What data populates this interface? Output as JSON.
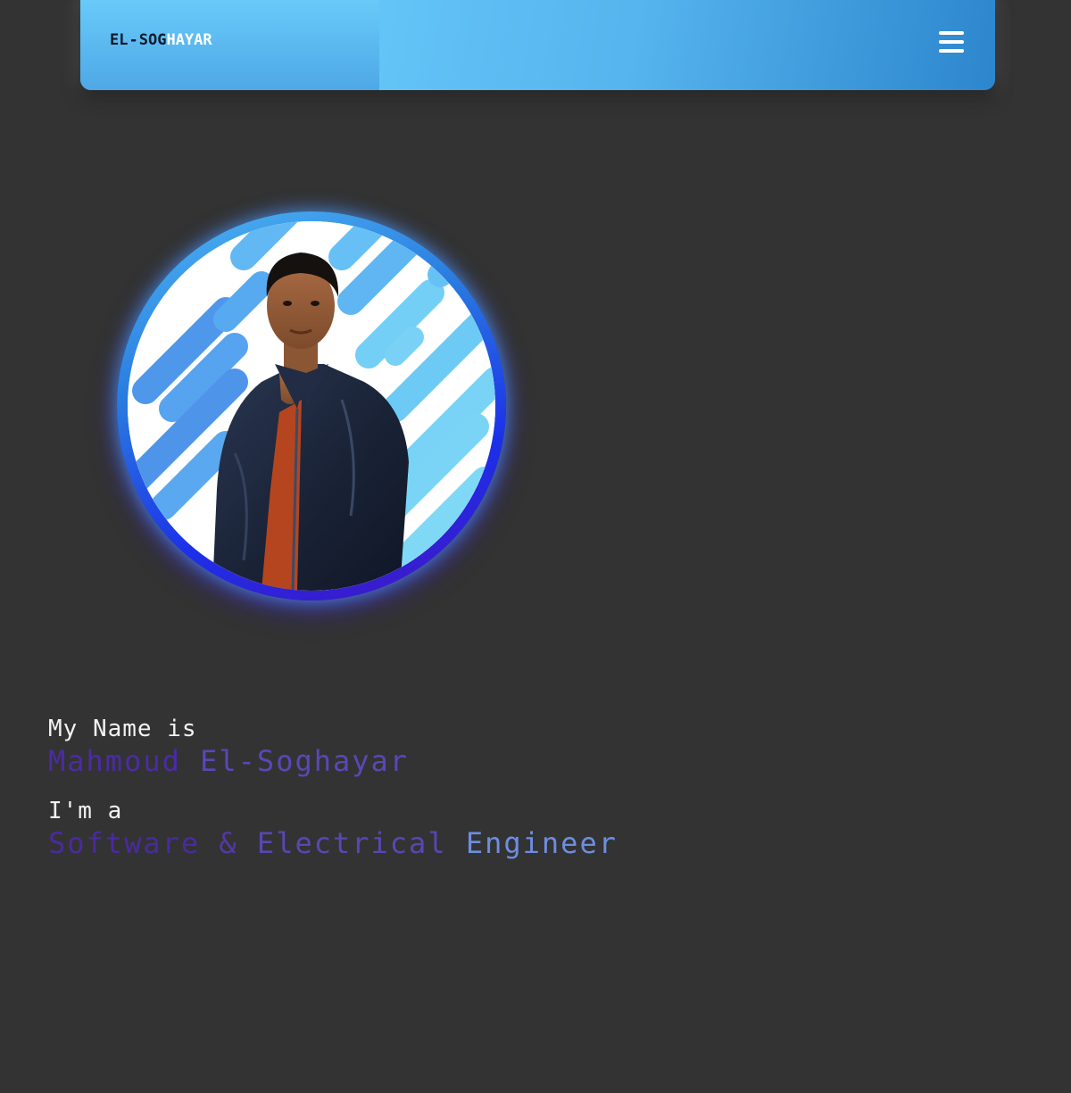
{
  "navbar": {
    "brand": {
      "part_dark": "EL",
      "part_dash": "-",
      "part_dark2": "SOG",
      "part_light": "HAYAR"
    },
    "menu_icon": "hamburger-menu-icon"
  },
  "hero": {
    "avatar_icon": "profile-photo",
    "name_label": "My Name is",
    "name_first": "Mahmoud",
    "name_last": "El-Soghayar",
    "role_label": "I'm a",
    "role_word1": "Software",
    "role_word2": "&",
    "role_word3": "Electrical",
    "role_word4": "Engineer"
  },
  "colors": {
    "background": "#333333",
    "nav_gradient_start": "#52aee9",
    "nav_gradient_end": "#2d86cd",
    "accent_purple": "#4b2ba6",
    "accent_blue": "#6d8ee0",
    "ring_blue": "#1c2fe8"
  }
}
